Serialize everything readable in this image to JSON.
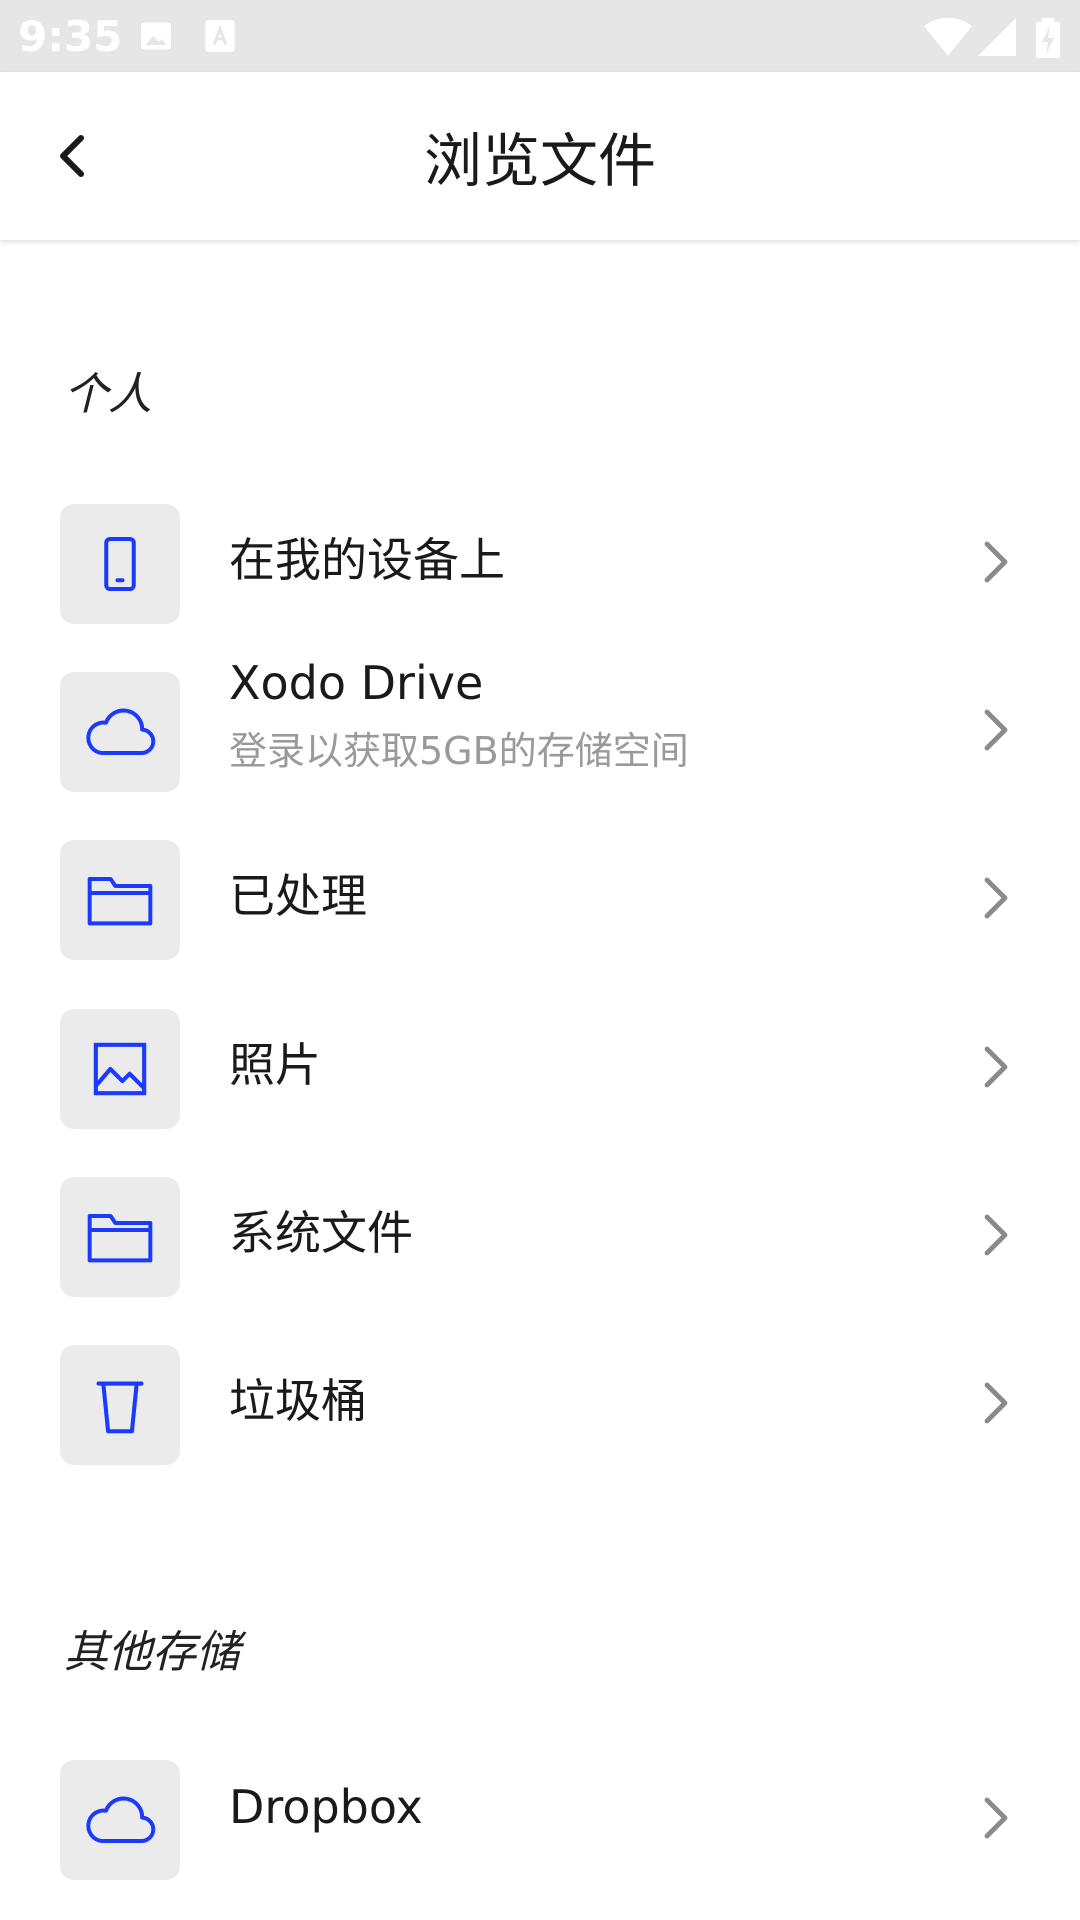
{
  "status_bar": {
    "time": "9:35",
    "icons": [
      "image-icon",
      "a11y-text-icon",
      "wifi-icon",
      "signal-icon",
      "battery-charging-icon"
    ]
  },
  "header": {
    "title": "浏览文件",
    "back_icon": "chevron-left-icon"
  },
  "sections": {
    "personal": {
      "title": "个人",
      "items": [
        {
          "label": "在我的设备上",
          "icon": "phone-icon"
        },
        {
          "label": "Xodo Drive",
          "subtitle": "登录以获取5GB的存储空间",
          "icon": "cloud-icon"
        },
        {
          "label": "已处理",
          "icon": "folder-icon"
        },
        {
          "label": "照片",
          "icon": "image-icon"
        },
        {
          "label": "系统文件",
          "icon": "folder-icon"
        },
        {
          "label": "垃圾桶",
          "icon": "trash-icon"
        }
      ]
    },
    "other": {
      "title": "其他存储",
      "items": [
        {
          "label": "Dropbox",
          "icon": "cloud-icon"
        }
      ]
    }
  },
  "colors": {
    "accent": "#1a3bff",
    "icon_bg": "#ebebeb",
    "status_bar_bg": "#e6e6e6",
    "chevron": "#8a8a8a",
    "subtitle": "#9a9a9a"
  }
}
